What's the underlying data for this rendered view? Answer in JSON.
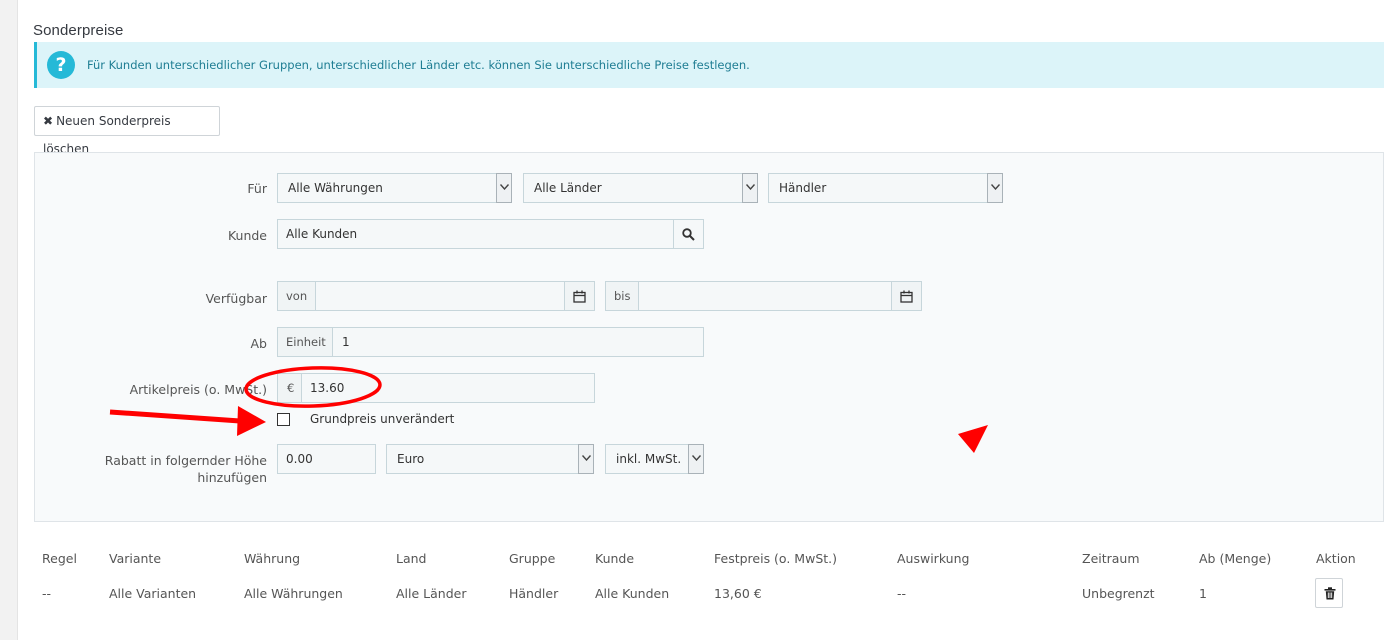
{
  "section_title": "Sonderpreise",
  "info": {
    "text": "Für Kunden unterschiedlicher Gruppen, unterschiedlicher Länder etc. können Sie unterschiedliche Preise festlegen."
  },
  "delete_button": {
    "label": "Neuen Sonderpreis löschen"
  },
  "form": {
    "fuer_label": "Für",
    "currency_value": "Alle Währungen",
    "country_value": "Alle Länder",
    "group_value": "Händler",
    "kunde_label": "Kunde",
    "kunde_value": "Alle Kunden",
    "verfuegbar_label": "Verfügbar",
    "von_label": "von",
    "von_value": "",
    "bis_label": "bis",
    "bis_value": "",
    "ab_label": "Ab",
    "einheit_label": "Einheit",
    "einheit_value": "1",
    "artikelpreis_label": "Artikelpreis (o. MwSt.)",
    "currency_symbol": "€",
    "price_value": "13.60",
    "grundpreis_label": "Grundpreis unverändert",
    "grundpreis_checked": false,
    "rabatt_label_line1": "Rabatt in folgernder Höhe",
    "rabatt_label_line2": "hinzufügen",
    "rabatt_value": "0.00",
    "rabatt_type_value": "Euro",
    "rabatt_tax_value": "inkl. MwSt."
  },
  "table": {
    "headers": [
      "Regel",
      "Variante",
      "Währung",
      "Land",
      "Gruppe",
      "Kunde",
      "Festpreis (o. MwSt.)",
      "Auswirkung",
      "Zeitraum",
      "Ab (Menge)",
      "Aktion"
    ],
    "rows": [
      [
        "--",
        "Alle Varianten",
        "Alle Währungen",
        "Alle Länder",
        "Händler",
        "Alle Kunden",
        "13,60 €",
        "--",
        "Unbegrenzt",
        "1",
        ""
      ]
    ]
  },
  "colors": {
    "accent": "#25b9d7",
    "annotation": "#ff0000"
  },
  "icons": [
    "question-icon",
    "close-icon",
    "chevron-down-icon",
    "search-icon",
    "calendar-icon",
    "trash-icon"
  ]
}
